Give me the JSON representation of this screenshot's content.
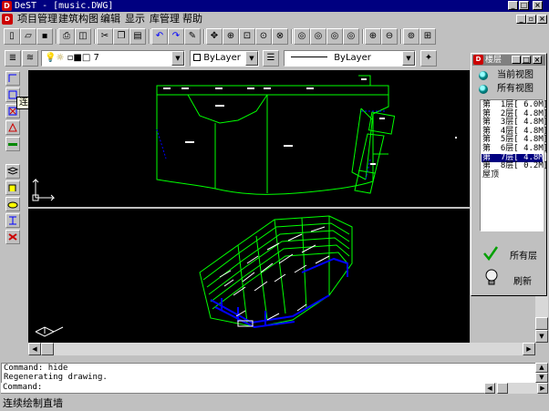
{
  "title_bar": {
    "title": "DeST - [music.DWG]",
    "window_controls": [
      "minimize-icon",
      "maximize-icon",
      "close-icon"
    ]
  },
  "menu": {
    "items": [
      "项目管理",
      "建筑构图",
      "编辑",
      "显示",
      "库管理",
      "帮助"
    ]
  },
  "toolbar": {
    "current_layer": "7",
    "color": "ByLayer",
    "linetype": "ByLayer"
  },
  "tooltip": "连续绘制直墙",
  "floor_panel": {
    "title": "楼层",
    "options": [
      "当前视图",
      "所有视图"
    ],
    "floors": [
      "第  1层[ 6.0M]",
      "第  2层[ 4.8M]",
      "第  3层[ 4.8M]",
      "第  4层[ 4.8M]",
      "第  5层[ 4.8M]",
      "第  6层[ 4.8M]",
      "第  7层[ 4.8M]",
      "第  8层[ 0.2M]",
      "屋顶"
    ],
    "selected_floor_index": 6,
    "all_floors_label": "所有层",
    "refresh_label": "刷新"
  },
  "command": {
    "history": [
      "Command: hide",
      "Regenerating drawing."
    ],
    "prompt": "Command:"
  },
  "status": "连续绘制直墙",
  "colors": {
    "title_bar": "#000080",
    "window_bg": "#c0c0c0",
    "canvas_bg": "#000000",
    "plan_lines": "#00ff00",
    "accent_blue": "#0000ff",
    "selection": "#000080"
  }
}
